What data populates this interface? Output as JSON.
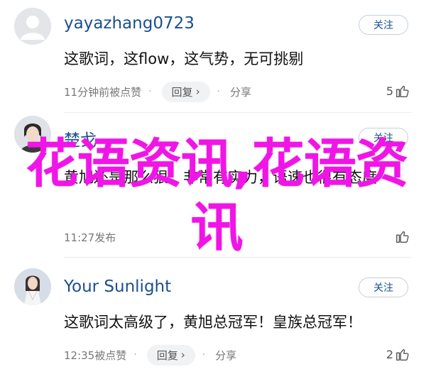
{
  "comments": [
    {
      "username": "yayazhang0723",
      "follow_label": "关注",
      "text": "这歌词，这flow，这气势，无可挑剔",
      "time": "11分钟前被点赞",
      "reply_label": "回复",
      "share_label": "分享",
      "likes": "5",
      "avatar": "default-avatar"
    },
    {
      "username": "楚戈",
      "follow_label": "关注",
      "text": "黄旭还是那么狠，非常有实力，语速也很有态度",
      "time": "11:27发布",
      "reply_label": "",
      "share_label": "",
      "likes": "",
      "avatar": "photo-avatar"
    },
    {
      "username": "Your Sunlight",
      "follow_label": "关注",
      "text": "这歌词太高级了，黄旭总冠军！皇族总冠军！",
      "time": "12:35被点赞",
      "reply_label": "回复",
      "share_label": "分享",
      "likes": "2",
      "avatar": "photo-avatar"
    }
  ],
  "watermark": {
    "text": "花语资讯,花语资讯",
    "color": "#f015e6"
  },
  "colors": {
    "username": "#1b4f8f",
    "meta": "#777777"
  }
}
